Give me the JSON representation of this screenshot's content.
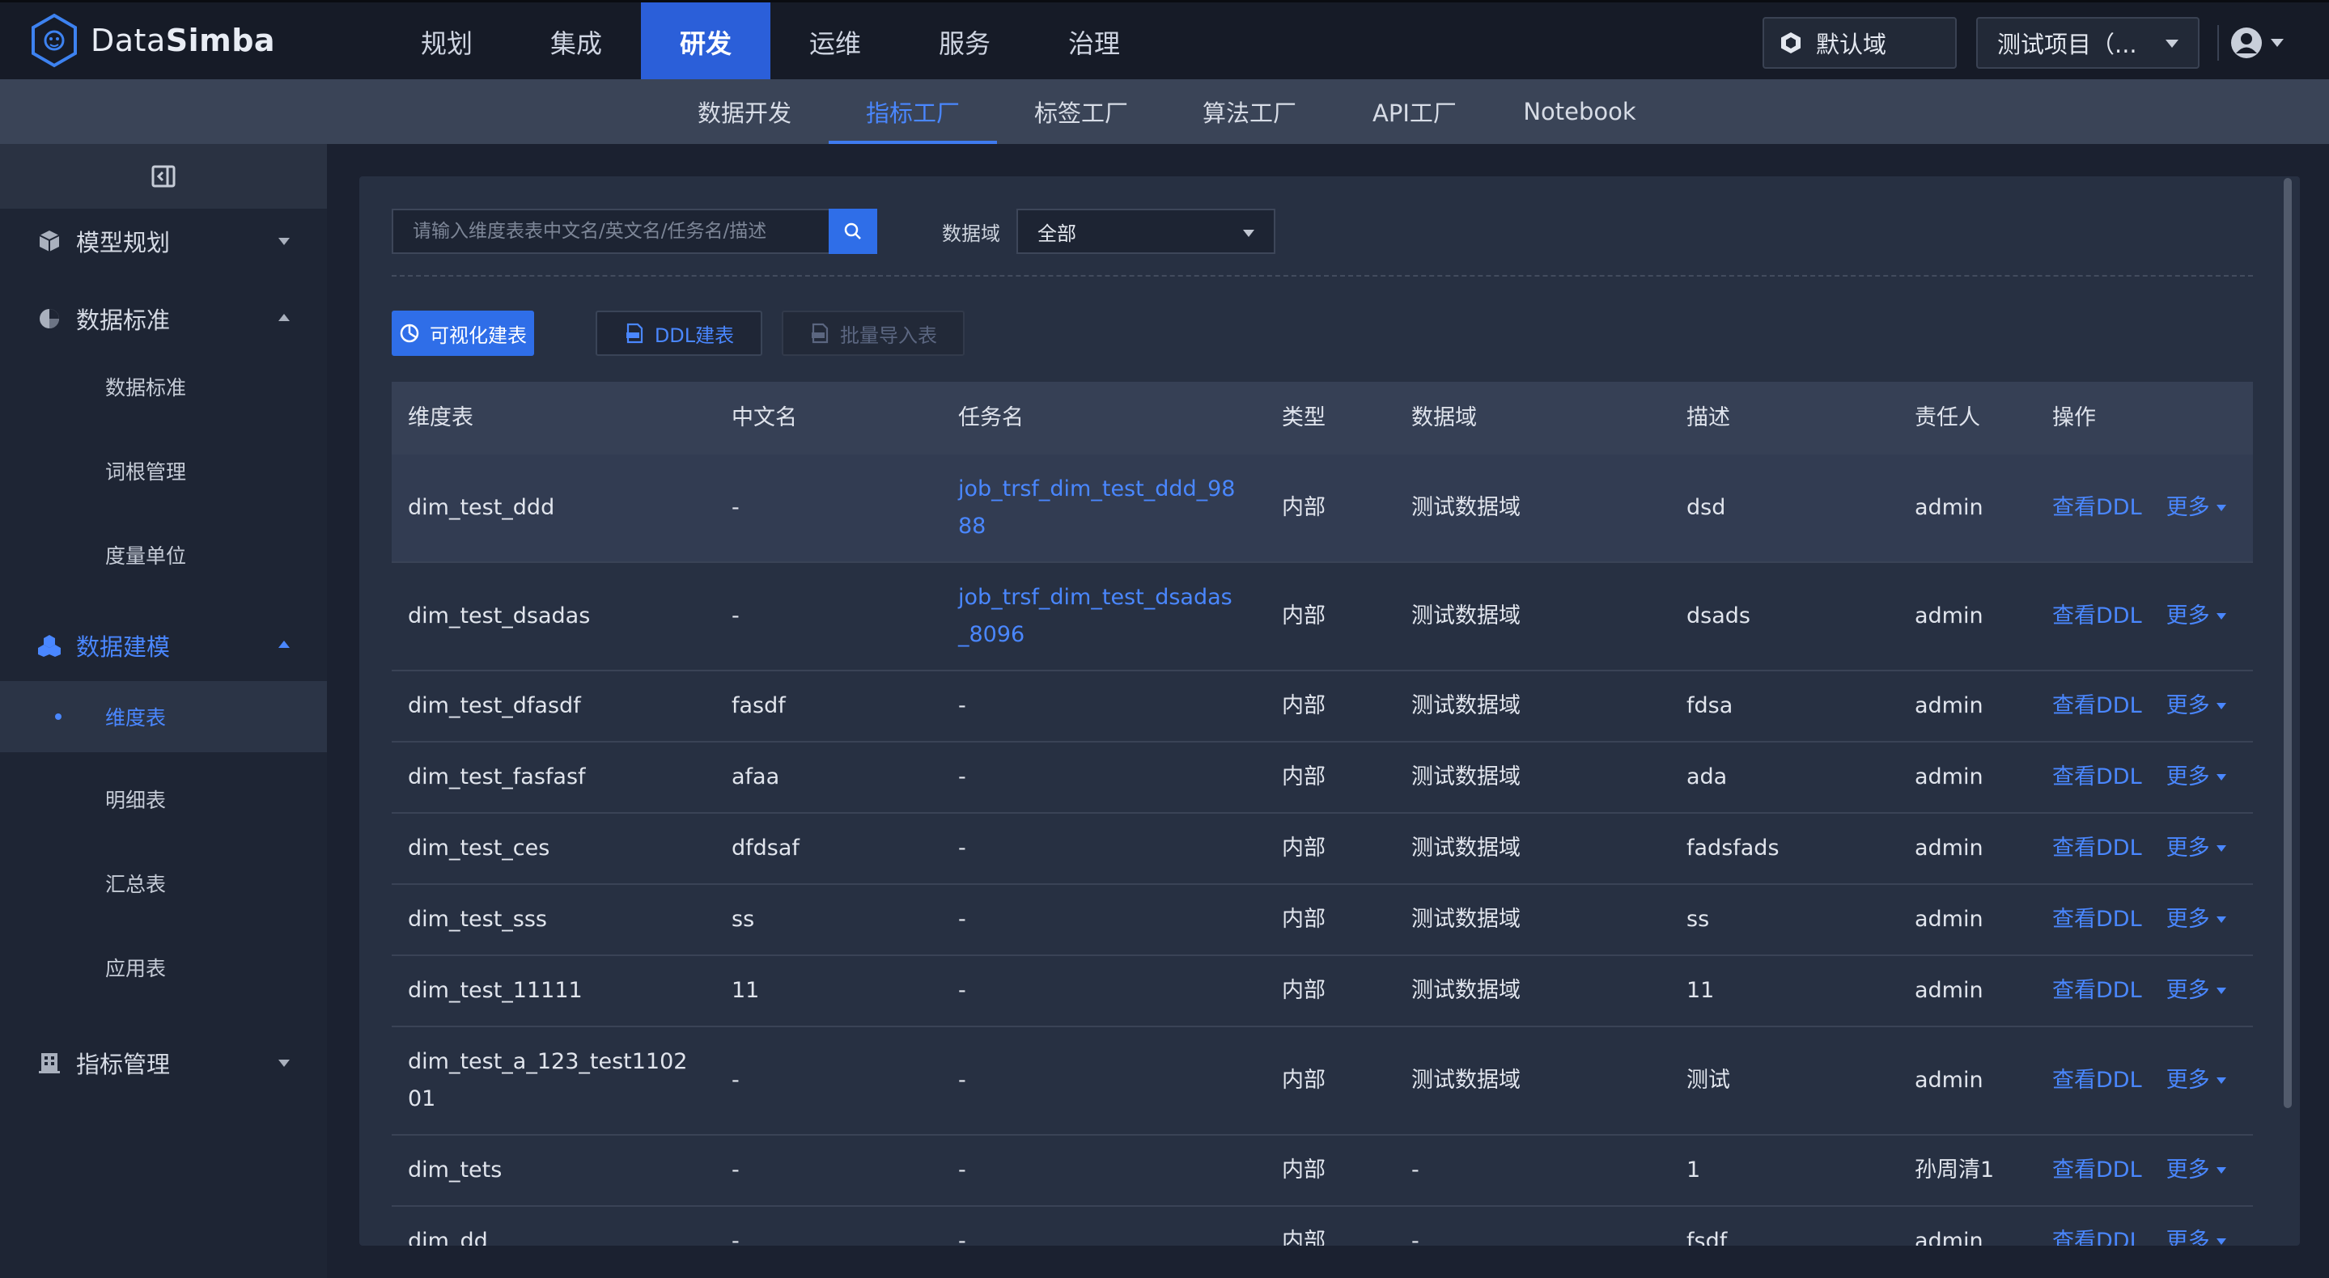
{
  "app": {
    "logo_text_light": "Data",
    "logo_text_bold": "Simba"
  },
  "main_nav": [
    {
      "label": "规划",
      "active": false
    },
    {
      "label": "集成",
      "active": false
    },
    {
      "label": "研发",
      "active": true
    },
    {
      "label": "运维",
      "active": false
    },
    {
      "label": "服务",
      "active": false
    },
    {
      "label": "治理",
      "active": false
    }
  ],
  "header": {
    "domain_button": "默认域",
    "project_select": "测试项目（..."
  },
  "sub_nav": [
    {
      "label": "数据开发",
      "active": false
    },
    {
      "label": "指标工厂",
      "active": true
    },
    {
      "label": "标签工厂",
      "active": false
    },
    {
      "label": "算法工厂",
      "active": false
    },
    {
      "label": "API工厂",
      "active": false
    },
    {
      "label": "Notebook",
      "active": false
    }
  ],
  "sidebar": {
    "groups": [
      {
        "label": "模型规划",
        "expanded": false
      },
      {
        "label": "数据标准",
        "expanded": true,
        "items": [
          "数据标准",
          "词根管理",
          "度量单位"
        ]
      },
      {
        "label": "数据建模",
        "expanded": true,
        "active": true,
        "items": [
          "维度表",
          "明细表",
          "汇总表",
          "应用表"
        ],
        "active_item": "维度表"
      },
      {
        "label": "指标管理",
        "expanded": false
      }
    ]
  },
  "toolbar": {
    "search_placeholder": "请输入维度表表中文名/英文名/任务名/描述",
    "domain_label": "数据域",
    "domain_value": "全部",
    "btn_visual": "可视化建表",
    "btn_ddl": "DDL建表",
    "btn_import": "批量导入表"
  },
  "table": {
    "columns": [
      "维度表",
      "中文名",
      "任务名",
      "类型",
      "数据域",
      "描述",
      "责任人",
      "操作"
    ],
    "op_view": "查看DDL",
    "op_more": "更多",
    "rows": [
      {
        "name": "dim_test_ddd",
        "cn": "-",
        "task": "job_trsf_dim_test_ddd_9888",
        "task_l1": "job_trsf_dim_test_ddd_98",
        "task_l2": "88",
        "type": "内部",
        "domain": "测试数据域",
        "desc": "dsd",
        "owner": "admin"
      },
      {
        "name": "dim_test_dsadas",
        "cn": "-",
        "task": "job_trsf_dim_test_dsadas_8096",
        "task_l1": "job_trsf_dim_test_dsadas",
        "task_l2": "_8096",
        "type": "内部",
        "domain": "测试数据域",
        "desc": "dsads",
        "owner": "admin"
      },
      {
        "name": "dim_test_dfasdf",
        "cn": "fasdf",
        "task": "-",
        "type": "内部",
        "domain": "测试数据域",
        "desc": "fdsa",
        "owner": "admin"
      },
      {
        "name": "dim_test_fasfasf",
        "cn": "afaa",
        "task": "-",
        "type": "内部",
        "domain": "测试数据域",
        "desc": "ada",
        "owner": "admin"
      },
      {
        "name": "dim_test_ces",
        "cn": "dfdsaf",
        "task": "-",
        "type": "内部",
        "domain": "测试数据域",
        "desc": "fadsfads",
        "owner": "admin"
      },
      {
        "name": "dim_test_sss",
        "cn": "ss",
        "task": "-",
        "type": "内部",
        "domain": "测试数据域",
        "desc": "ss",
        "owner": "admin"
      },
      {
        "name": "dim_test_11111",
        "cn": "11",
        "task": "-",
        "type": "内部",
        "domain": "测试数据域",
        "desc": "11",
        "owner": "admin"
      },
      {
        "name": "dim_test_a_123_test110201",
        "name_l1": "dim_test_a_123_test1102",
        "name_l2": "01",
        "cn": "-",
        "task": "-",
        "type": "内部",
        "domain": "测试数据域",
        "desc": "测试",
        "owner": "admin"
      },
      {
        "name": "dim_tets",
        "cn": "-",
        "task": "-",
        "type": "内部",
        "domain": "-",
        "desc": "1",
        "owner": "孙周清1"
      },
      {
        "name": "dim_dd",
        "cn": "-",
        "task": "-",
        "type": "内部",
        "domain": "-",
        "desc": "fsdf",
        "owner": "admin"
      }
    ]
  },
  "colors": {
    "accent": "#2f6ee8",
    "link": "#4a87ff",
    "bg": "#1b2130",
    "panel": "#273042"
  }
}
